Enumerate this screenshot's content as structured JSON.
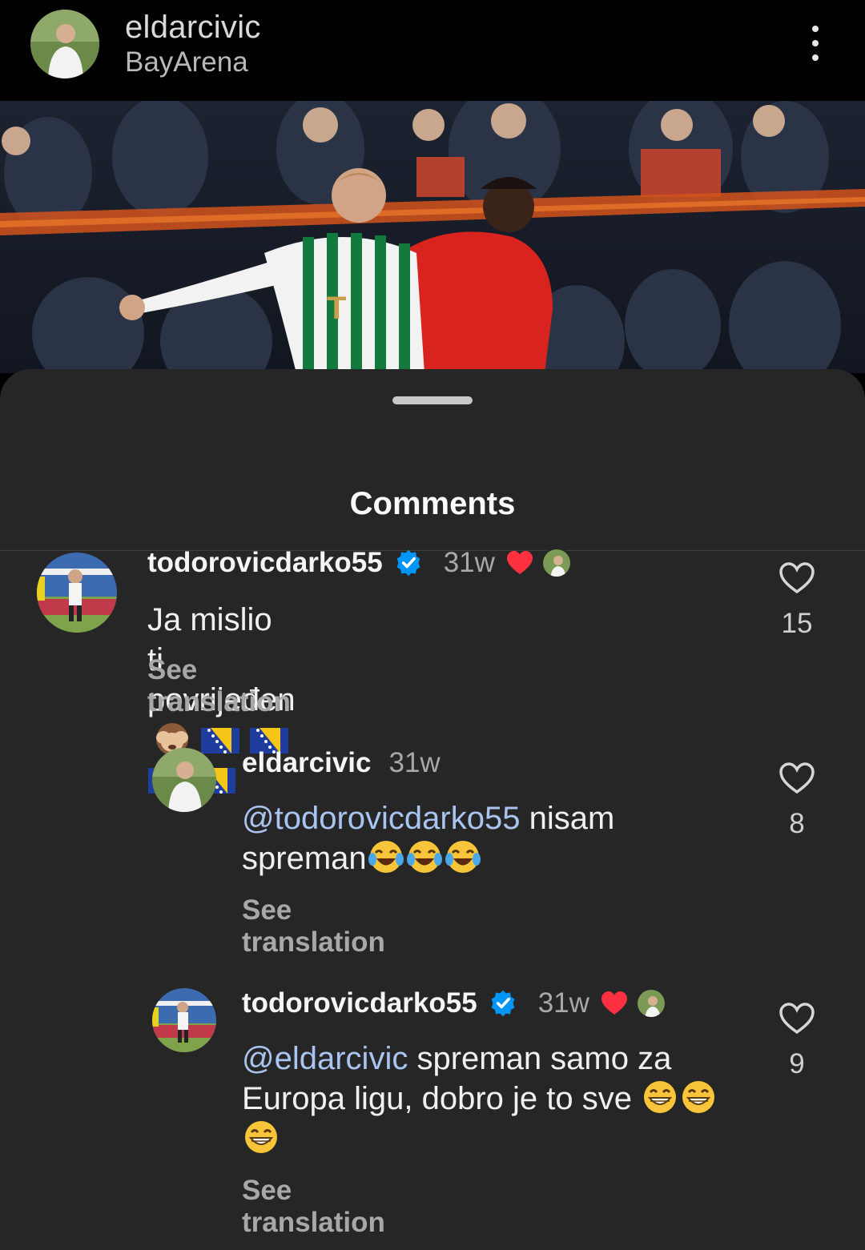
{
  "header": {
    "username": "eldarcivic",
    "location": "BayArena",
    "more_icon": "more-vertical-icon"
  },
  "sheet": {
    "title": "Comments"
  },
  "comments": [
    {
      "username": "todorovicdarko55",
      "verified": true,
      "time": "31w",
      "liked_by_author": true,
      "text": "Ja mislio ti povrijeđen",
      "emojis": [
        "see-no-evil-monkey",
        "flag-bosnia",
        "flag-bosnia",
        "flag-bosnia",
        "flag-bosnia"
      ],
      "see_translation": "See translation",
      "likes": "15"
    },
    {
      "username": "eldarcivic",
      "verified": false,
      "time": "31w",
      "mention": "@todorovicdarko55",
      "text_line1": " nisam",
      "text_line2": "spreman",
      "emojis": [
        "face-with-tears-of-joy",
        "face-with-tears-of-joy",
        "face-with-tears-of-joy"
      ],
      "see_translation": "See translation",
      "likes": "8"
    },
    {
      "username": "todorovicdarko55",
      "verified": true,
      "time": "31w",
      "liked_by_author": true,
      "mention": "@eldarcivic",
      "text_line1": " spreman samo za",
      "text_line2": "Europa ligu, dobro je to sve",
      "emojis": [
        "grinning-face",
        "grinning-face",
        "grinning-face"
      ],
      "see_translation": "See translation",
      "likes": "9"
    }
  ],
  "colors": {
    "background": "#000000",
    "sheet": "#262626",
    "verified": "#0095f6",
    "heart": "#ff3040",
    "mention": "#a9c4f0"
  }
}
